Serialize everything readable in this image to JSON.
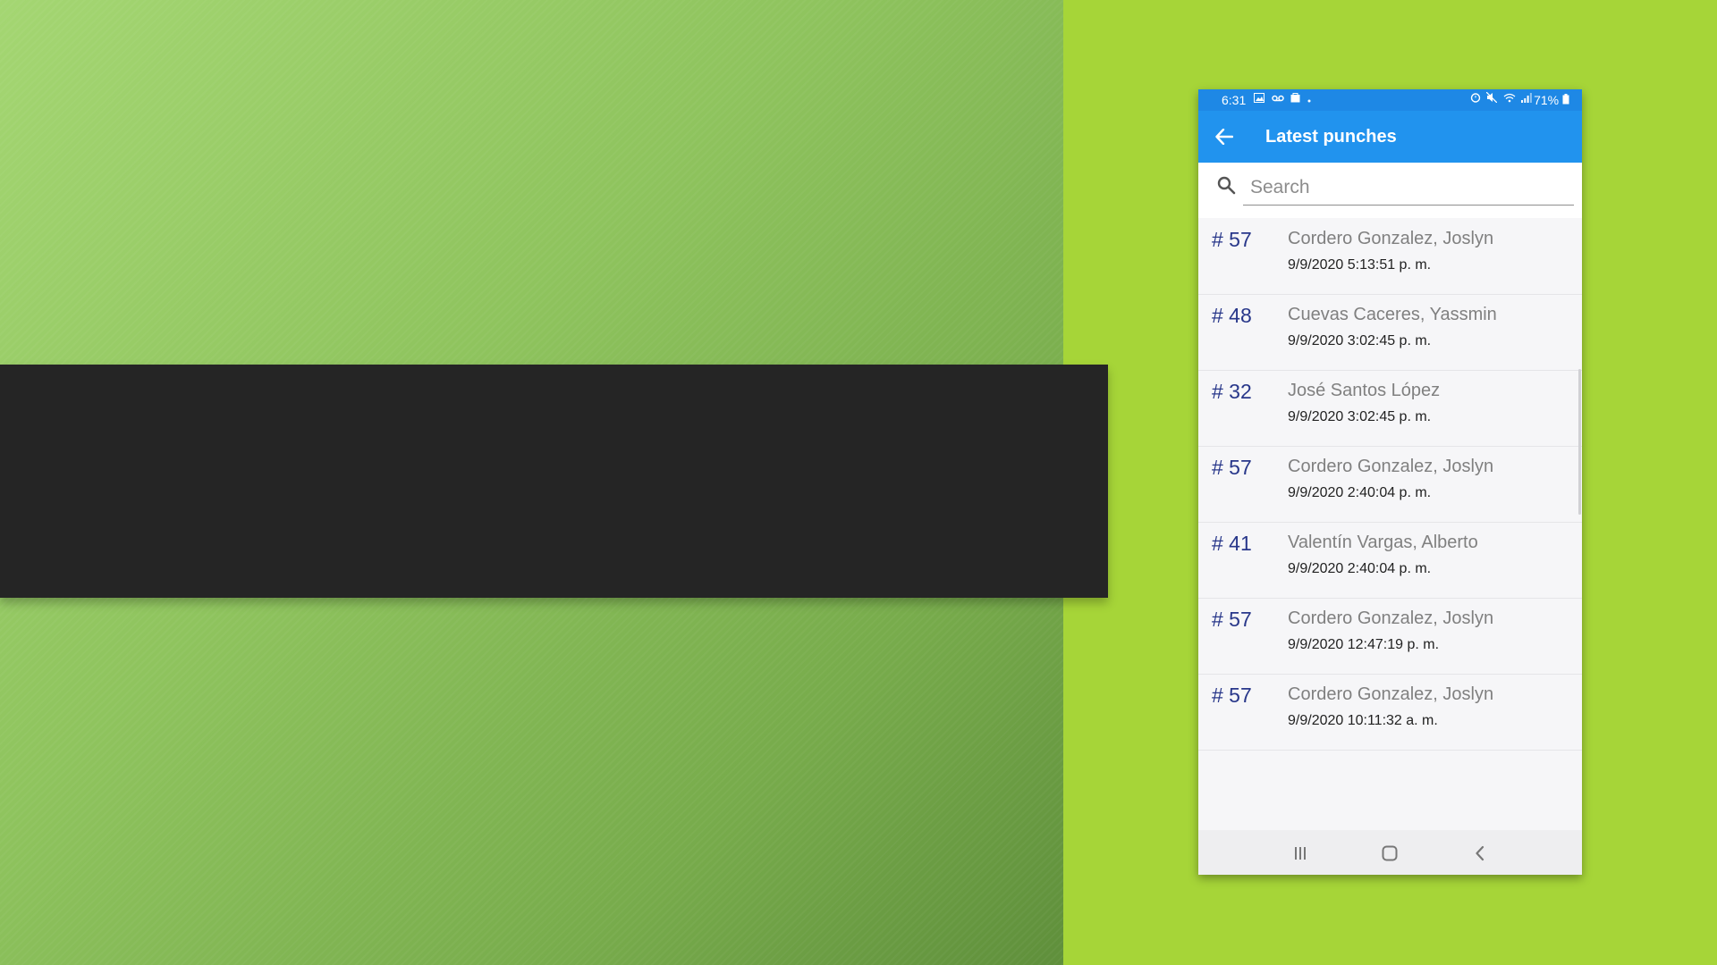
{
  "status_bar": {
    "time": "6:31",
    "left_icons": [
      "image-icon",
      "voicemail-icon",
      "bag-icon",
      "dot"
    ],
    "right_icons": [
      "alarm-icon",
      "mute-icon",
      "wifi-icon",
      "signal-icon"
    ],
    "battery_text": "71%"
  },
  "app_bar": {
    "title": "Latest punches",
    "back_icon": "arrow-left-icon",
    "background": "#2193ee"
  },
  "search": {
    "placeholder": "Search",
    "value": ""
  },
  "punches": [
    {
      "number": "# 57",
      "name": "Cordero Gonzalez, Joslyn",
      "datetime": "9/9/2020 5:13:51 p. m."
    },
    {
      "number": "# 48",
      "name": "Cuevas Caceres, Yassmin",
      "datetime": "9/9/2020 3:02:45 p. m."
    },
    {
      "number": "# 32",
      "name": "José Santos López",
      "datetime": "9/9/2020 3:02:45 p. m."
    },
    {
      "number": "# 57",
      "name": "Cordero Gonzalez, Joslyn",
      "datetime": "9/9/2020 2:40:04 p. m."
    },
    {
      "number": "# 41",
      "name": "Valentín Vargas, Alberto",
      "datetime": "9/9/2020 2:40:04 p. m."
    },
    {
      "number": "# 57",
      "name": "Cordero Gonzalez, Joslyn",
      "datetime": "9/9/2020 12:47:19 p. m."
    },
    {
      "number": "# 57",
      "name": "Cordero Gonzalez, Joslyn",
      "datetime": "9/9/2020 10:11:32 a. m."
    }
  ],
  "nav_bar": {
    "buttons": [
      "recent-apps-icon",
      "home-icon",
      "back-icon"
    ]
  },
  "colors": {
    "accent": "#2193ee",
    "number_text": "#28378a",
    "slide_green": "#a6d538",
    "dark_band": "#252525"
  }
}
